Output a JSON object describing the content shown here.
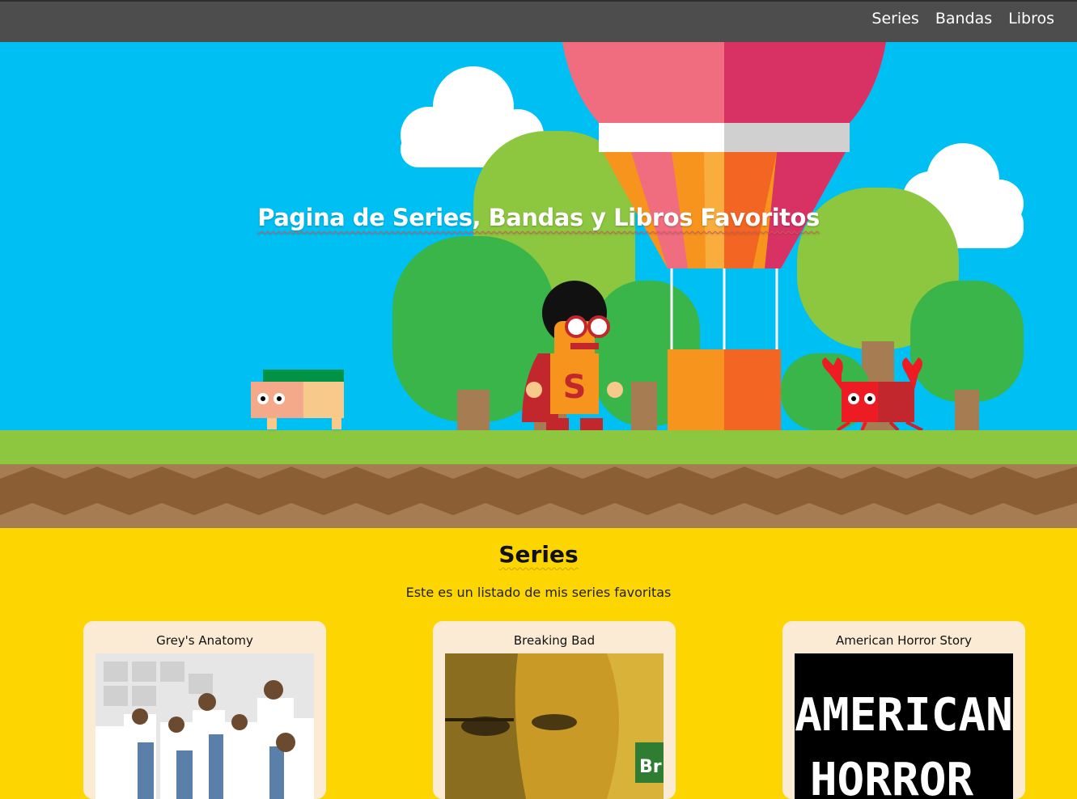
{
  "nav": {
    "links": [
      {
        "label": "Series"
      },
      {
        "label": "Bandas"
      },
      {
        "label": "Libros"
      }
    ]
  },
  "hero": {
    "title": "Pagina de Series, Bandas y Libros Favoritos",
    "hero_letter": "S"
  },
  "series": {
    "title": "Series",
    "subtitle": "Este es un listado de mis series favoritas",
    "items": [
      {
        "title": "Grey's Anatomy"
      },
      {
        "title": "Breaking Bad",
        "badge": "Br"
      },
      {
        "title": "American Horror Story",
        "poster_line1": "AMERICAN",
        "poster_line2": "HORROR"
      }
    ]
  },
  "colors": {
    "nav_bg": "#4d4d4d",
    "sky": "#00bff3",
    "section_bg": "#fdd500",
    "card_bg": "#fcebd4"
  }
}
